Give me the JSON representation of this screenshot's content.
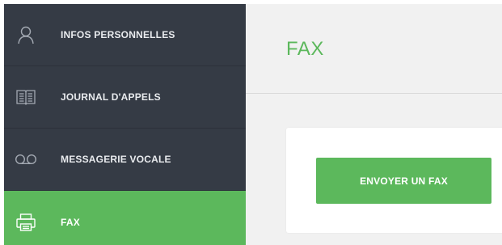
{
  "sidebar": {
    "items": [
      {
        "label": "INFOS PERSONNELLES",
        "icon": "user-icon",
        "active": false
      },
      {
        "label": "JOURNAL D'APPELS",
        "icon": "book-icon",
        "active": false
      },
      {
        "label": "MESSAGERIE VOCALE",
        "icon": "voicemail-icon",
        "active": false
      },
      {
        "label": "FAX",
        "icon": "printer-icon",
        "active": true
      }
    ]
  },
  "main": {
    "title": "FAX",
    "send_button_label": "ENVOYER UN FAX"
  },
  "colors": {
    "sidebar_bg": "#353b45",
    "accent": "#5cb85c",
    "content_bg": "#f1f1f1"
  }
}
